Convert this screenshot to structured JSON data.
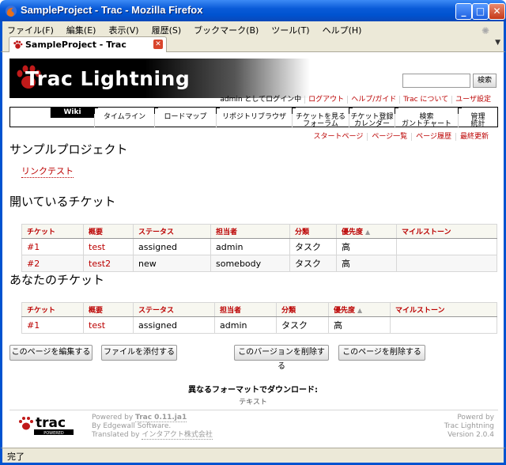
{
  "window": {
    "title": "SampleProject - Trac - Mozilla Firefox",
    "min": "_",
    "max": "□",
    "close": "✕"
  },
  "menu": [
    "ファイル(F)",
    "編集(E)",
    "表示(V)",
    "履歴(S)",
    "ブックマーク(B)",
    "ツール(T)",
    "ヘルプ(H)"
  ],
  "tab": {
    "label": "SampleProject - Trac"
  },
  "header": {
    "logo": "Trac Lightning",
    "search_button": "検索"
  },
  "metanav": {
    "user": "admin としてログイン中",
    "logout": "ログアウト",
    "help": "ヘルプ/ガイド",
    "about": "Trac について",
    "prefs": "ユーザ設定"
  },
  "mainnav": {
    "wiki": "Wiki",
    "timeline": "タイムライン",
    "roadmap": "ロードマップ",
    "browser": "リポジトリブラウザ",
    "view_tickets": "チケットを見る",
    "new_ticket": "チケット登録",
    "search": "検索",
    "admin": "管理",
    "forum": "フォーラム",
    "calendar": "カレンダー",
    "gantt": "ガントチャート",
    "stats": "統計"
  },
  "ctxtnav": [
    "スタートページ",
    "ページ一覧",
    "ページ履歴",
    "最終更新"
  ],
  "page": {
    "title": "サンプルプロジェクト",
    "link_test": "リンクテスト",
    "open_tickets_heading": "開いているチケット",
    "my_tickets_heading": "あなたのチケット"
  },
  "ticket_columns": [
    "チケット",
    "概要",
    "ステータス",
    "担当者",
    "分類",
    "優先度",
    "マイルストーン"
  ],
  "open_tickets": [
    [
      "#1",
      "test",
      "assigned",
      "admin",
      "タスク",
      "高",
      ""
    ],
    [
      "#2",
      "test2",
      "new",
      "somebody",
      "タスク",
      "高",
      ""
    ]
  ],
  "my_tickets": [
    [
      "#1",
      "test",
      "assigned",
      "admin",
      "タスク",
      "高",
      ""
    ]
  ],
  "buttons": {
    "edit": "このページを編集する",
    "attach": "ファイルを添付する",
    "delete_version": "このバージョンを削除する",
    "delete_page": "このページを削除する"
  },
  "altlinks": {
    "heading": "異なるフォーマットでダウンロード:",
    "text": "テキスト"
  },
  "footer": {
    "powered": "Powered by",
    "trac_version": "Trac 0.11.ja1",
    "by": "By Edgewall Software.",
    "translated": "Translated by",
    "translator": "インタアクト株式会社",
    "right1": "Powerd by",
    "right2": "Trac Lightning",
    "right3": "Version 2.0.4"
  },
  "status": "完了"
}
